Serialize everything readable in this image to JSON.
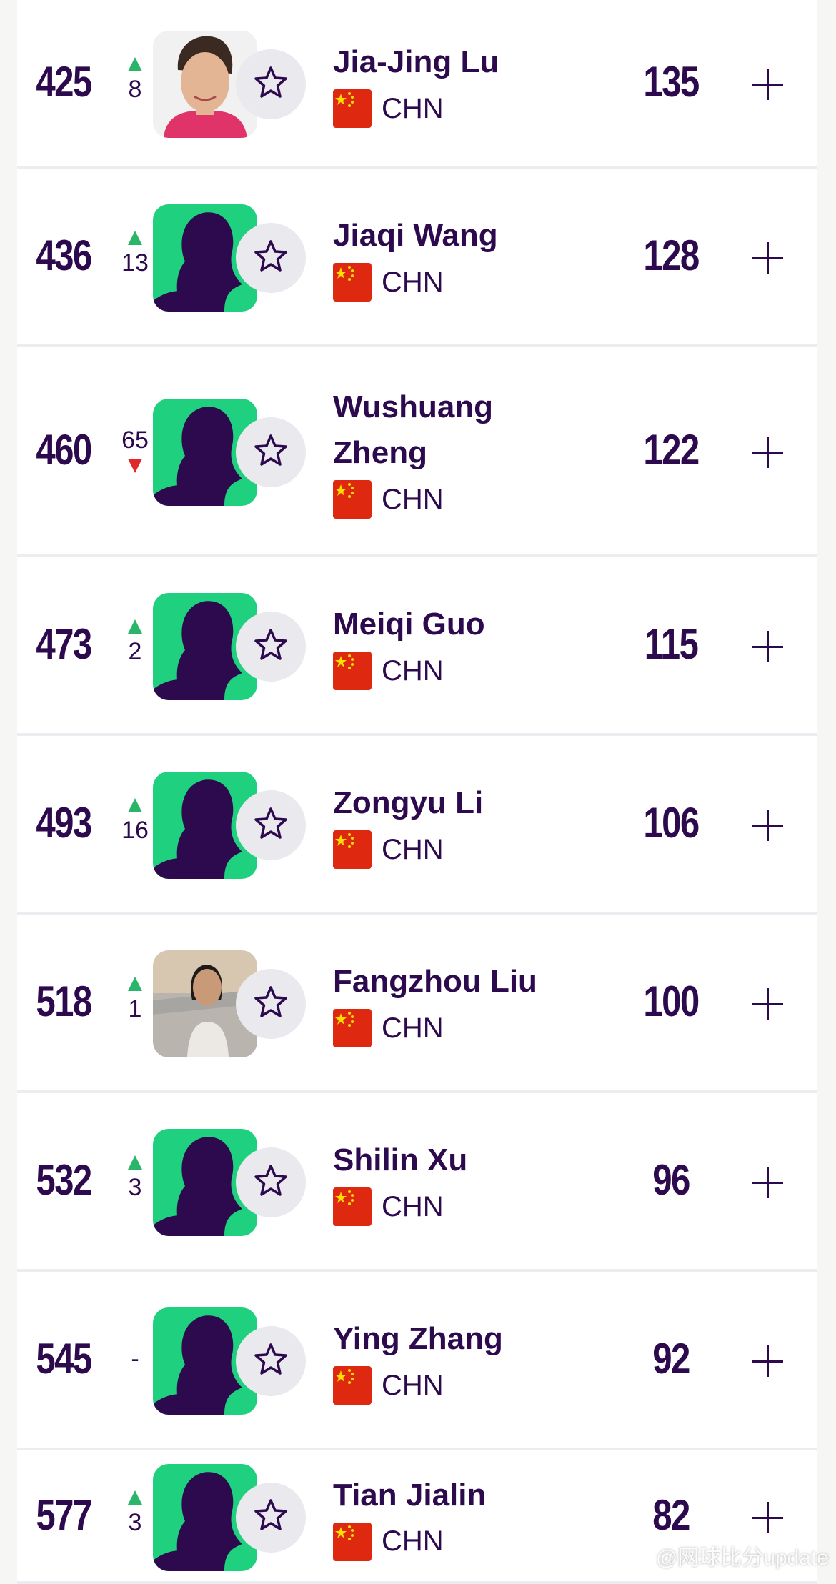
{
  "players": [
    {
      "rank": "425",
      "move_dir": "up",
      "move": "8",
      "name_lines": [
        "Jia-Jing Lu"
      ],
      "country": "CHN",
      "points": "135",
      "avatar": "photo-1"
    },
    {
      "rank": "436",
      "move_dir": "up",
      "move": "13",
      "name_lines": [
        "Jiaqi Wang"
      ],
      "country": "CHN",
      "points": "128",
      "avatar": "silhouette"
    },
    {
      "rank": "460",
      "move_dir": "down",
      "move": "65",
      "name_lines": [
        "Wushuang",
        "Zheng"
      ],
      "country": "CHN",
      "points": "122",
      "avatar": "silhouette"
    },
    {
      "rank": "473",
      "move_dir": "up",
      "move": "2",
      "name_lines": [
        "Meiqi Guo"
      ],
      "country": "CHN",
      "points": "115",
      "avatar": "silhouette"
    },
    {
      "rank": "493",
      "move_dir": "up",
      "move": "16",
      "name_lines": [
        "Zongyu Li"
      ],
      "country": "CHN",
      "points": "106",
      "avatar": "silhouette"
    },
    {
      "rank": "518",
      "move_dir": "up",
      "move": "1",
      "name_lines": [
        "Fangzhou Liu"
      ],
      "country": "CHN",
      "points": "100",
      "avatar": "photo-2"
    },
    {
      "rank": "532",
      "move_dir": "up",
      "move": "3",
      "name_lines": [
        "Shilin Xu"
      ],
      "country": "CHN",
      "points": "96",
      "avatar": "silhouette"
    },
    {
      "rank": "545",
      "move_dir": "none",
      "move": "-",
      "name_lines": [
        "Ying Zhang"
      ],
      "country": "CHN",
      "points": "92",
      "avatar": "silhouette"
    },
    {
      "rank": "577",
      "move_dir": "up",
      "move": "3",
      "name_lines": [
        "Tian Jialin"
      ],
      "country": "CHN",
      "points": "82",
      "avatar": "silhouette"
    }
  ],
  "icons": {
    "favorite": "star-outline-icon",
    "expand": "plus-icon",
    "flag": "china-flag-icon",
    "up": "triangle-up-icon",
    "down": "triangle-down-icon"
  },
  "colors": {
    "text": "#2d0a4e",
    "up": "#2ab56a",
    "down": "#e0282d",
    "silhouette_bg": "#1fd17e",
    "silhouette": "#2d0a4e"
  },
  "watermark": {
    "text": "@网球比分update"
  }
}
